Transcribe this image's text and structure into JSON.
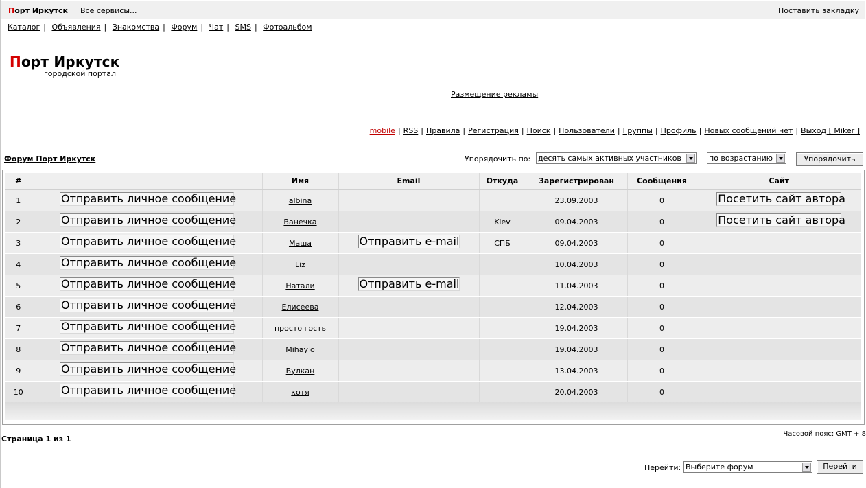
{
  "topbar": {
    "brand_first": "П",
    "brand_rest": "орт Иркутск",
    "all_services": "Все сервисы...",
    "bookmark": "Поставить закладку"
  },
  "services_nav": [
    "Каталог",
    "Объявления",
    "Знакомства",
    "Форум",
    "Чат",
    "SMS",
    "Фотоальбом"
  ],
  "logo": {
    "first": "П",
    "rest": "орт Иркутск",
    "subtitle": "городской портал"
  },
  "ads_link": "Размещение рекламы",
  "user_nav": {
    "mobile": "mobile",
    "items": [
      "RSS",
      "Правила",
      "Регистрация",
      "Поиск",
      "Пользователи",
      "Группы",
      "Профиль",
      "Новых сообщений нет",
      "Выход [ Miker ]"
    ]
  },
  "forum_link": "Форум Порт Иркутск",
  "sort": {
    "label": "Упорядочить по:",
    "field_value": "десять самых активных участников",
    "order_value": "по возрастанию",
    "button": "Упорядочить"
  },
  "table": {
    "headers": [
      "#",
      "",
      "Имя",
      "Email",
      "Откуда",
      "Зарегистрирован",
      "Сообщения",
      "Сайт"
    ],
    "pm_label": "Отправить личное сообщение",
    "email_label": "Отправить e-mail",
    "site_label": "Посетить сайт автора",
    "rows": [
      {
        "n": "1",
        "name": "albina",
        "email": false,
        "from": "",
        "registered": "23.09.2003",
        "posts": "0",
        "site": true
      },
      {
        "n": "2",
        "name": "Ванечка",
        "email": false,
        "from": "Kiev",
        "registered": "09.04.2003",
        "posts": "0",
        "site": true
      },
      {
        "n": "3",
        "name": "Маша",
        "email": true,
        "from": "СПБ",
        "registered": "09.04.2003",
        "posts": "0",
        "site": false
      },
      {
        "n": "4",
        "name": "Liz",
        "email": false,
        "from": "",
        "registered": "10.04.2003",
        "posts": "0",
        "site": false
      },
      {
        "n": "5",
        "name": "Натали",
        "email": true,
        "from": "",
        "registered": "11.04.2003",
        "posts": "0",
        "site": false
      },
      {
        "n": "6",
        "name": "Елисеева",
        "email": false,
        "from": "",
        "registered": "12.04.2003",
        "posts": "0",
        "site": false
      },
      {
        "n": "7",
        "name": "просто гость",
        "email": false,
        "from": "",
        "registered": "19.04.2003",
        "posts": "0",
        "site": false
      },
      {
        "n": "8",
        "name": "Mihaylo",
        "email": false,
        "from": "",
        "registered": "19.04.2003",
        "posts": "0",
        "site": false
      },
      {
        "n": "9",
        "name": "Вулкан",
        "email": false,
        "from": "",
        "registered": "13.04.2003",
        "posts": "0",
        "site": false
      },
      {
        "n": "10",
        "name": "котя",
        "email": false,
        "from": "",
        "registered": "20.04.2003",
        "posts": "0",
        "site": false
      }
    ]
  },
  "page_info": "Страница 1 из 1",
  "timezone": "Часовой пояс: GMT + 8",
  "jump": {
    "label": "Перейти:",
    "select_value": "Выберите форум",
    "button": "Перейти"
  },
  "colors": {
    "brand_red": "#d40000",
    "mobile_red": "#c00000"
  }
}
